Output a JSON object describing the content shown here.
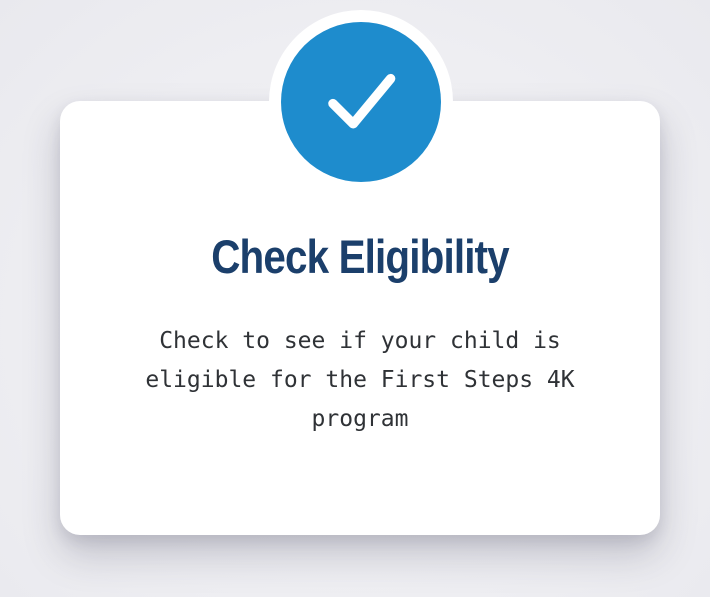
{
  "card": {
    "icon": "checkmark-icon",
    "title": "Check Eligibility",
    "description": "Check to see if your child is eligible for the First Steps 4K program"
  },
  "colors": {
    "badge": "#1e8ccd",
    "title": "#1b3f6b",
    "description": "#2f3236",
    "card": "#ffffff",
    "background": "#ececf0"
  }
}
